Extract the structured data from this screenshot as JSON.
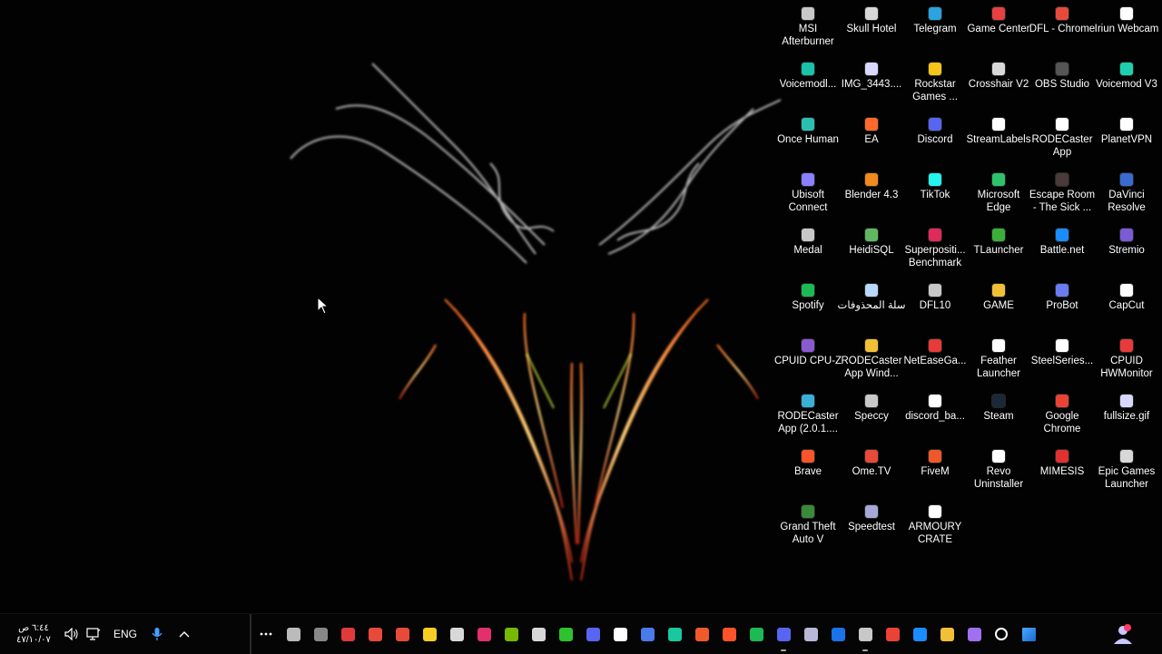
{
  "desktop": {
    "icons": [
      {
        "label": "MSI Afterburner",
        "color": "#c8c8c8"
      },
      {
        "label": "Skull Hotel",
        "color": "#d8d8d8"
      },
      {
        "label": "Telegram",
        "color": "#2aa3e0"
      },
      {
        "label": "Game Center",
        "color": "#e84040"
      },
      {
        "label": "DFL - Chrome",
        "color": "#e84a3a"
      },
      {
        "label": "Iriun Webcam",
        "color": "#ffffff"
      },
      {
        "label": "Voicemodl...",
        "color": "#19c2a8"
      },
      {
        "label": "IMG_3443....",
        "color": "#d8d8ff"
      },
      {
        "label": "Rockstar Games ...",
        "color": "#f5c518"
      },
      {
        "label": "Crosshair V2",
        "color": "#d8d8d8"
      },
      {
        "label": "OBS Studio",
        "color": "#555555"
      },
      {
        "label": "Voicemod V3",
        "color": "#1ed0b0"
      },
      {
        "label": "Once Human",
        "color": "#2bbfb0"
      },
      {
        "label": "EA",
        "color": "#ff6a2c"
      },
      {
        "label": "Discord",
        "color": "#5865f2"
      },
      {
        "label": "StreamLabels",
        "color": "#ffffff"
      },
      {
        "label": "RODECaster App",
        "color": "#ffffff"
      },
      {
        "label": "PlanetVPN",
        "color": "#ffffff"
      },
      {
        "label": "Ubisoft Connect",
        "color": "#8a7fff"
      },
      {
        "label": "Blender 4.3",
        "color": "#f08a1c"
      },
      {
        "label": "TikTok",
        "color": "#25f4ee"
      },
      {
        "label": "Microsoft Edge",
        "color": "#2ec26b"
      },
      {
        "label": "Escape Room - The Sick ...",
        "color": "#4a3a3a"
      },
      {
        "label": "DaVinci Resolve",
        "color": "#3a6ad0"
      },
      {
        "label": "Medal",
        "color": "#c8c8c8"
      },
      {
        "label": "HeidiSQL",
        "color": "#5fb85f"
      },
      {
        "label": "Superpositi... Benchmark",
        "color": "#e02a5a"
      },
      {
        "label": "TLauncher",
        "color": "#3ab03a"
      },
      {
        "label": "Battle.net",
        "color": "#1a8cff"
      },
      {
        "label": "Stremio",
        "color": "#7b5bd6"
      },
      {
        "label": "Spotify",
        "color": "#1db954"
      },
      {
        "label": "سلة المحذوفات",
        "color": "#b8d8ff"
      },
      {
        "label": "DFL10",
        "color": "#c8c8c8"
      },
      {
        "label": "GAME",
        "color": "#f2c037"
      },
      {
        "label": "ProBot",
        "color": "#6a7cf0"
      },
      {
        "label": "CapCut",
        "color": "#ffffff"
      },
      {
        "label": "CPUID CPU-Z",
        "color": "#8a5ad0"
      },
      {
        "label": "RODECaster App Wind...",
        "color": "#f2c037"
      },
      {
        "label": "NetEaseGa...",
        "color": "#e83a3a"
      },
      {
        "label": "Feather Launcher",
        "color": "#ffffff"
      },
      {
        "label": "SteelSeries...",
        "color": "#ffffff"
      },
      {
        "label": "CPUID HWMonitor",
        "color": "#e83a3a"
      },
      {
        "label": "RODECaster App (2.0.1....",
        "color": "#3ab0d8"
      },
      {
        "label": "Speccy",
        "color": "#c8c8c8"
      },
      {
        "label": "discord_ba...",
        "color": "#ffffff"
      },
      {
        "label": "Steam",
        "color": "#1b2838"
      },
      {
        "label": "Google Chrome",
        "color": "#ea4335"
      },
      {
        "label": "fullsize.gif",
        "color": "#d8d8ff"
      },
      {
        "label": "Brave",
        "color": "#fb542b"
      },
      {
        "label": "Ome.TV",
        "color": "#e84a3a"
      },
      {
        "label": "FiveM",
        "color": "#f0572b"
      },
      {
        "label": "Revo Uninstaller",
        "color": "#ffffff"
      },
      {
        "label": "MIMESIS",
        "color": "#e03030"
      },
      {
        "label": "Epic Games Launcher",
        "color": "#d8d8d8"
      },
      {
        "label": "Grand Theft Auto V",
        "color": "#3a8a3a"
      },
      {
        "label": "Speedtest",
        "color": "#a8a8d8"
      },
      {
        "label": "ARMOURY CRATE",
        "color": "#ffffff"
      }
    ]
  },
  "taskbar": {
    "clock_time": "٦:٤٤ ص",
    "clock_date": "٤٧/١٠/٠٧",
    "language": "ENG",
    "apps": [
      {
        "name": "taskbar-search-app",
        "color": "#bbbbbb",
        "running": false
      },
      {
        "name": "taskbar-app-1",
        "color": "#888888",
        "running": false
      },
      {
        "name": "taskbar-app-2",
        "color": "#e03a3a",
        "running": false
      },
      {
        "name": "taskbar-app-3",
        "color": "#e84a3a",
        "running": false
      },
      {
        "name": "taskbar-app-4",
        "color": "#e84a3a",
        "running": false
      },
      {
        "name": "taskbar-app-5",
        "color": "#f5d020",
        "running": false
      },
      {
        "name": "taskbar-app-6",
        "color": "#d8d8d8",
        "running": false
      },
      {
        "name": "taskbar-instagram",
        "color": "#e1306c",
        "running": false
      },
      {
        "name": "taskbar-nvidia",
        "color": "#76b900",
        "running": false
      },
      {
        "name": "taskbar-steelseries",
        "color": "#d8d8d8",
        "running": false
      },
      {
        "name": "taskbar-xbox",
        "color": "#2ec22e",
        "running": false
      },
      {
        "name": "taskbar-discord",
        "color": "#5865f2",
        "running": false
      },
      {
        "name": "taskbar-app-13",
        "color": "#ffffff",
        "running": false
      },
      {
        "name": "taskbar-app-14",
        "color": "#4a7be8",
        "running": false
      },
      {
        "name": "taskbar-vpn",
        "color": "#1ac8a0",
        "running": false
      },
      {
        "name": "taskbar-app-16",
        "color": "#f05a2a",
        "running": false
      },
      {
        "name": "taskbar-brave",
        "color": "#fb542b",
        "running": false
      },
      {
        "name": "taskbar-spotify",
        "color": "#1db954",
        "running": false
      },
      {
        "name": "taskbar-discord-2",
        "color": "#5865f2",
        "running": true
      },
      {
        "name": "taskbar-app-20",
        "color": "#b8b8d8",
        "running": false
      },
      {
        "name": "taskbar-outlook",
        "color": "#1a73e8",
        "running": false
      },
      {
        "name": "taskbar-app-22",
        "color": "#c8c8c8",
        "running": true
      },
      {
        "name": "taskbar-chrome",
        "color": "#ea4335",
        "running": false
      },
      {
        "name": "taskbar-edge",
        "color": "#1a8cff",
        "running": false
      },
      {
        "name": "taskbar-explorer",
        "color": "#f2c037",
        "running": false
      },
      {
        "name": "taskbar-copilot",
        "color": "#a070f0",
        "running": false
      },
      {
        "name": "taskbar-search",
        "color": "#ffffff",
        "running": false
      },
      {
        "name": "taskbar-start",
        "color": "#1a8cff",
        "running": false
      }
    ]
  }
}
